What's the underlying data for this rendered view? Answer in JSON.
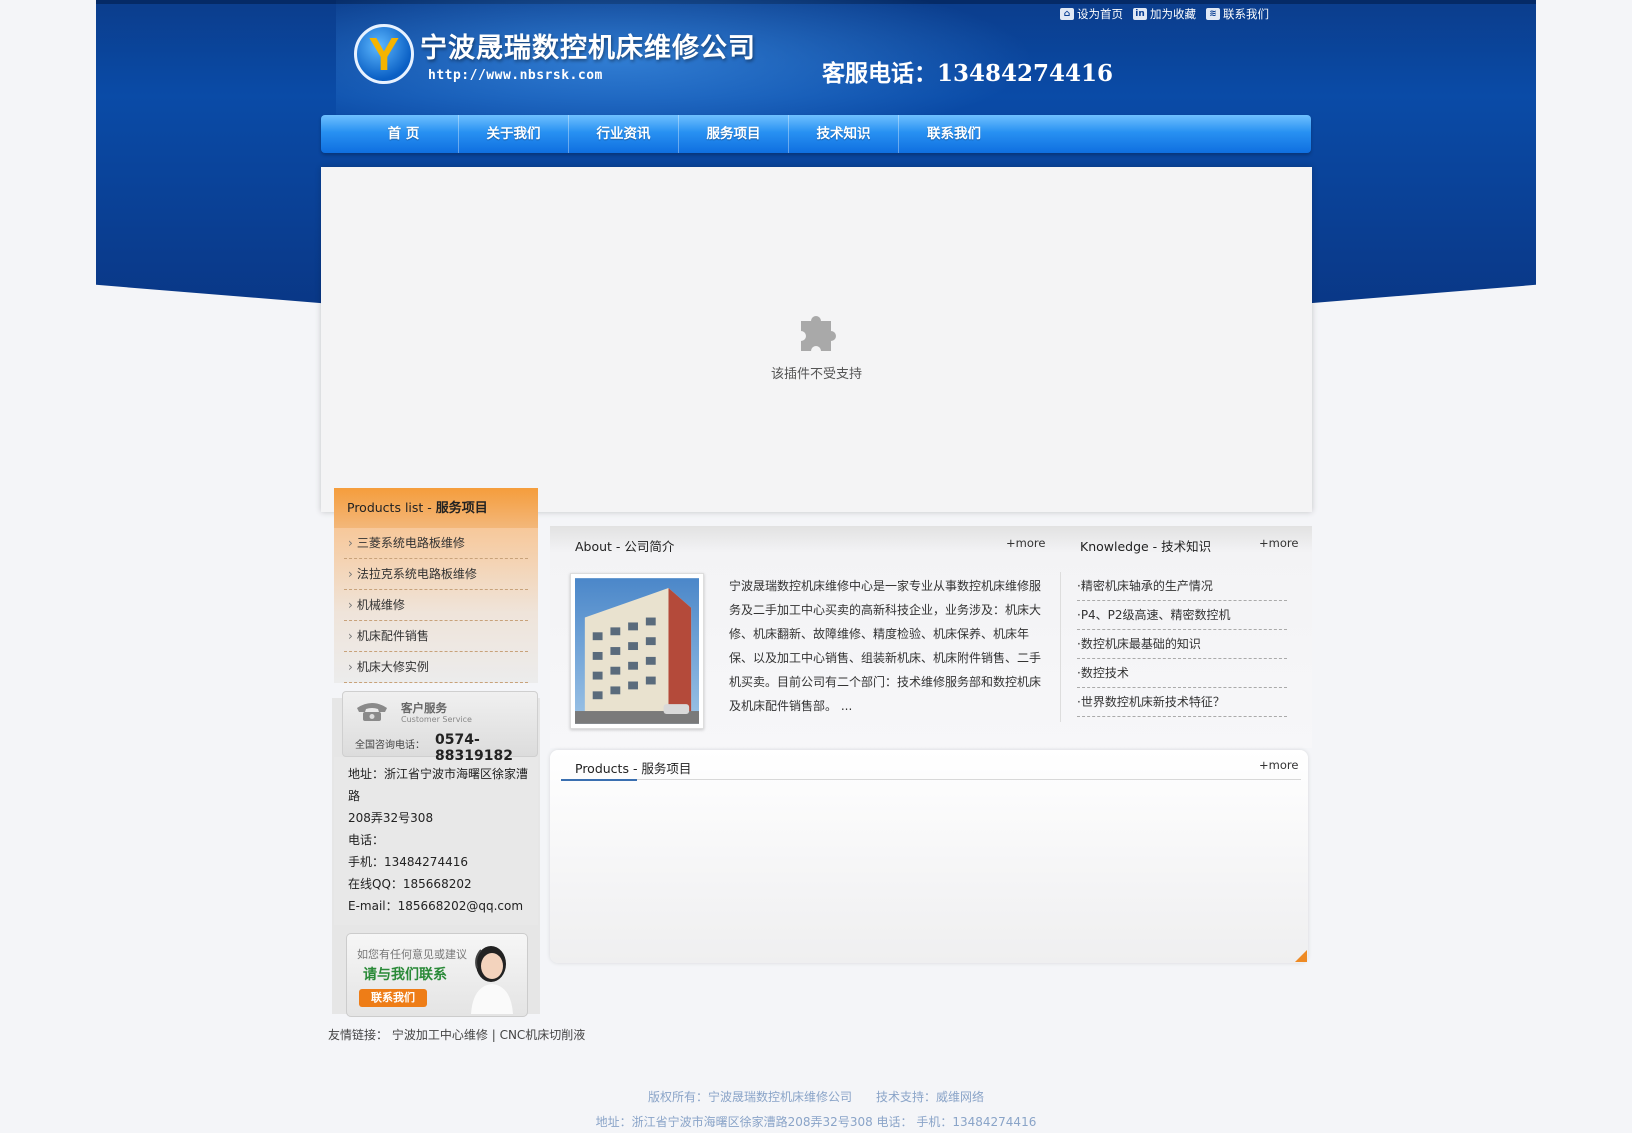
{
  "header": {
    "company_name": "宁波晟瑞数控机床维修公司",
    "url": "http://www.nbsrsk.com",
    "hotline": "客服电话：13484274416",
    "toplinks": [
      "设为首页",
      "加为收藏",
      "联系我们"
    ]
  },
  "nav": [
    "首 页",
    "关于我们",
    "行业资讯",
    "服务项目",
    "技术知识",
    "联系我们"
  ],
  "banner": {
    "plugin_message": "该插件不受支持"
  },
  "products_list": {
    "title_en": "Products list - ",
    "title_cn": "服务项目",
    "items": [
      "三菱系统电路板维修",
      "法拉克系统电路板维修",
      "机械维修",
      "机床配件销售",
      "机床大修实例"
    ]
  },
  "service": {
    "title": "客户服务",
    "subtitle": "Customer Service",
    "hotline_label": "全国咨询电话：",
    "hotline_number": "0574-88319182"
  },
  "contact": {
    "address_l1": "地址：浙江省宁波市海曙区徐家漕路",
    "address_l2": "208弄32号308",
    "tel": "电话：",
    "mobile": "手机：13484274416",
    "qq": "在线QQ：185668202",
    "email": "E-mail：185668202@qq.com"
  },
  "suggest": {
    "line1": "如您有任何意见或建议",
    "line2": "请与我们联系",
    "button": "联系我们"
  },
  "about": {
    "title": "About - 公司简介",
    "more": "+more",
    "text": "宁波晟瑞数控机床维修中心是一家专业从事数控机床维修服务及二手加工中心买卖的高新科技企业，业务涉及：机床大修、机床翻新、故障维修、精度检验、机床保养、机床年保、以及加工中心销售、组装新机床、机床附件销售、二手机买卖。目前公司有二个部门：技术维修服务部和数控机床及机床配件销售部。 ..."
  },
  "knowledge": {
    "title": "Knowledge - 技术知识",
    "more": "+more",
    "items": [
      "·精密机床轴承的生产情况",
      "·P4、P2级高速、精密数控机",
      "·数控机床最基础的知识",
      "·数控技术",
      "·世界数控机床新技术特征？"
    ]
  },
  "products": {
    "title": "Products - 服务项目",
    "more": "+more"
  },
  "friend_links": {
    "label": "友情链接：",
    "links": [
      "宁波加工中心维修",
      "CNC机床切削液"
    ],
    "sep": "|"
  },
  "footer": {
    "line1": "版权所有：宁波晟瑞数控机床维修公司　　技术支持：威维网络",
    "line2": "地址：浙江省宁波市海曙区徐家漕路208弄32号308  电话：   手机：13484274416"
  },
  "colors": {
    "header_blue": "#0a4ba7",
    "nav_blue": "#2891f2",
    "accent_orange": "#f59d3c",
    "footer_text": "#8aa4c8"
  }
}
